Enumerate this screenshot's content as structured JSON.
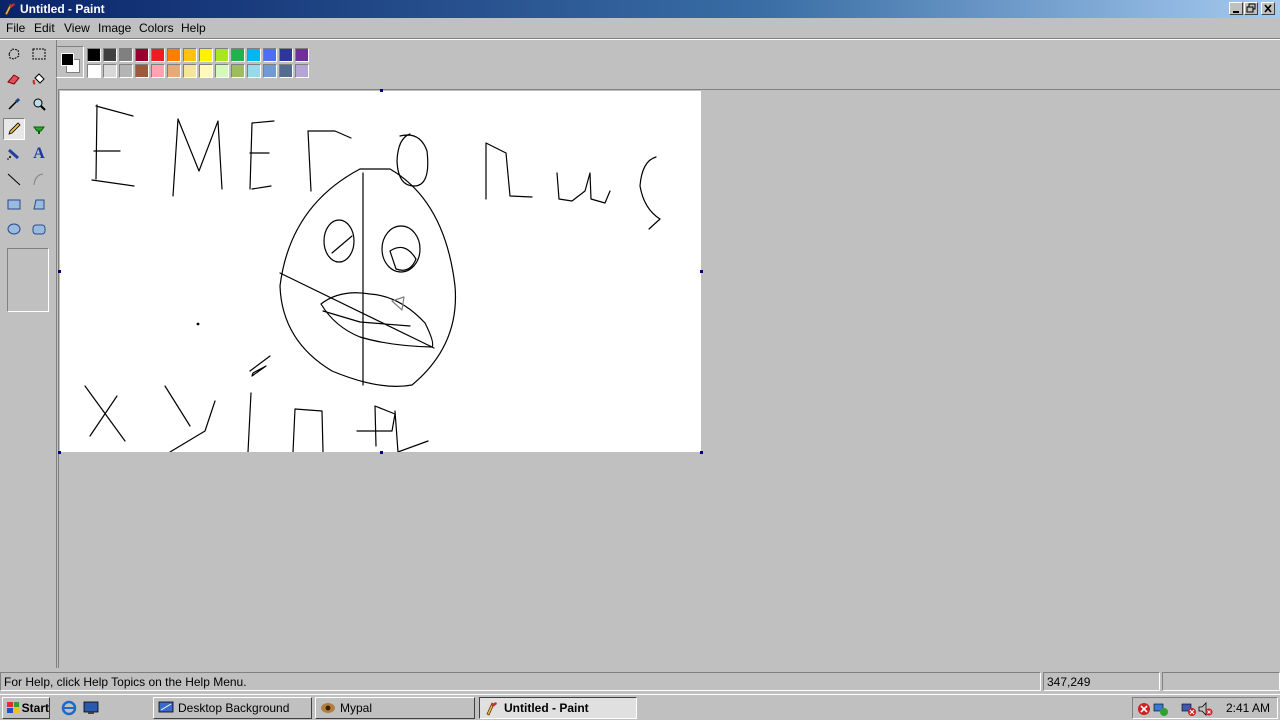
{
  "window": {
    "title": "Untitled - Paint",
    "controls": [
      "minimize",
      "restore",
      "close"
    ]
  },
  "menu": [
    "File",
    "Edit",
    "View",
    "Image",
    "Colors",
    "Help"
  ],
  "tools": [
    {
      "name": "free-form-select"
    },
    {
      "name": "select"
    },
    {
      "name": "eraser"
    },
    {
      "name": "fill-with-color"
    },
    {
      "name": "pick-color"
    },
    {
      "name": "magnifier"
    },
    {
      "name": "pencil",
      "active": true
    },
    {
      "name": "brush"
    },
    {
      "name": "airbrush"
    },
    {
      "name": "text",
      "glyph": "A"
    },
    {
      "name": "line"
    },
    {
      "name": "curve"
    },
    {
      "name": "rectangle"
    },
    {
      "name": "polygon"
    },
    {
      "name": "ellipse"
    },
    {
      "name": "rounded-rectangle"
    }
  ],
  "palette": {
    "foreground": "#000000",
    "background": "#ffffff",
    "top_row": [
      "#000000",
      "#404040",
      "#808080",
      "#990030",
      "#ed1c24",
      "#ff7e00",
      "#ffc20e",
      "#fff200",
      "#a8e61d",
      "#22b14c",
      "#00b7ef",
      "#4d6df3",
      "#2f3699",
      "#6f3198"
    ],
    "bottom_row": [
      "#ffffff",
      "#d8d8d8",
      "#b4b4b4",
      "#9c5a3c",
      "#ffa3b1",
      "#e5aa7a",
      "#f5e49c",
      "#fff9bd",
      "#d3f9bc",
      "#9dbb61",
      "#99d9ea",
      "#709ad1",
      "#546d8e",
      "#b5a5d5"
    ]
  },
  "status": {
    "help_text": "For Help, click Help Topics on the Help Menu.",
    "coordinates": "347,249",
    "size": ""
  },
  "taskbar": {
    "start_label": "Start",
    "tasks": [
      {
        "label": "Desktop Background",
        "active": false
      },
      {
        "label": "Mypal",
        "active": false
      },
      {
        "label": "Untitled - Paint",
        "active": true
      }
    ],
    "clock": "2:41 AM"
  },
  "colors": {
    "titlebar_start": "#0a246a",
    "titlebar_end": "#a6caf0",
    "face": "#c0c0c0"
  }
}
